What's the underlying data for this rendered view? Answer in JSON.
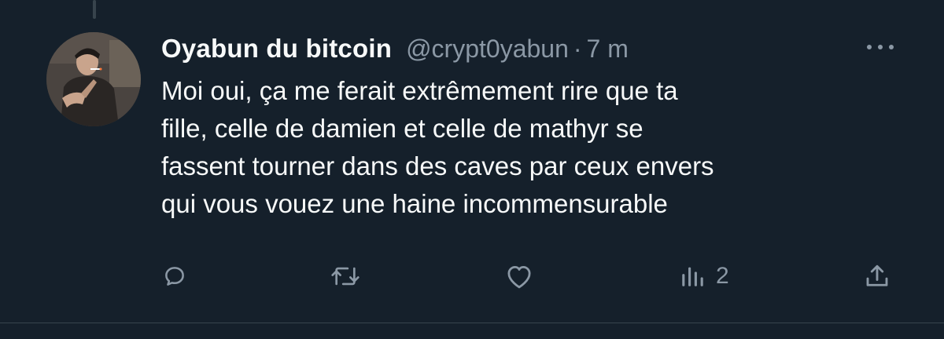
{
  "tweet": {
    "display_name": "Oyabun du bitcoin",
    "handle": "@crypt0yabun",
    "separator": "·",
    "time": "7 m",
    "text": "Moi oui, ça me ferait extrêmement rire que ta\nfille, celle de damien et celle de mathyr se\nfassent tourner dans des caves par ceux envers\nqui vous vouez une haine incommensurable"
  },
  "actions": {
    "reply_icon": "reply-icon",
    "retweet_icon": "retweet-icon",
    "like_icon": "heart-icon",
    "views_icon": "views-icon",
    "views_count": "2",
    "share_icon": "share-icon"
  },
  "colors": {
    "background": "#15202b",
    "text_primary": "#f7f9f9",
    "text_secondary": "#8b98a5",
    "divider": "#38444d"
  }
}
